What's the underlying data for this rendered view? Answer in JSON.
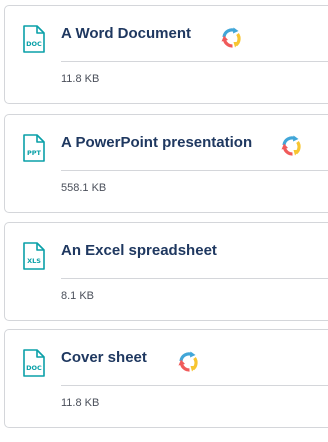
{
  "files": [
    {
      "badge": "DOC",
      "title": "A Word Document",
      "size": "11.8 KB",
      "icon": "doc-file-icon",
      "has_sync": true
    },
    {
      "badge": "PPT",
      "title": "A PowerPoint presentation",
      "size": "558.1 KB",
      "icon": "ppt-file-icon",
      "has_sync": true
    },
    {
      "badge": "XLS",
      "title": "An Excel spreadsheet",
      "size": "8.1 KB",
      "icon": "xls-file-icon",
      "has_sync": false
    },
    {
      "badge": "DOC",
      "title": "Cover sheet",
      "size": "11.8 KB",
      "icon": "doc-file-icon",
      "has_sync": true
    }
  ],
  "colors": {
    "accent": "#0aa0a8",
    "title": "#1f3860",
    "border": "#d4d6da",
    "size_text": "#4a4f5a",
    "sync_blue": "#41a6d8",
    "sync_red": "#f05a5a",
    "sync_yellow": "#f7c531"
  }
}
